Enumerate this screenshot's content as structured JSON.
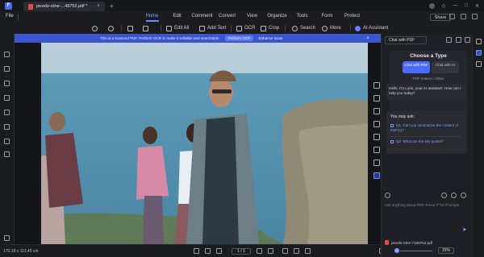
{
  "titlebar": {
    "tab_title": "pexels-rdne-...48752.pdf *",
    "tab_close": "×",
    "tab_add": "+"
  },
  "menubar": {
    "file": "File",
    "menus": [
      "Home",
      "Edit",
      "Comment",
      "Convert",
      "View",
      "Organize",
      "Tools",
      "Form",
      "Protect"
    ],
    "active": "Home",
    "share": "Share"
  },
  "toolbar": {
    "edit_all": "Edit All",
    "add_text": "Add Text",
    "ocr": "OCR",
    "crop": "Crop",
    "search": "Search",
    "more": "More",
    "ai_assistant": "AI Assistant"
  },
  "ocr_banner": {
    "message": "This is a scanned PDF. Perform OCR to make it editable and searchable.",
    "perform": "Perform OCR",
    "enhance": "Enhance Scan",
    "close": "×"
  },
  "statusbar": {
    "dimensions": "170.18 x 113.45 cm",
    "page": "1 / 1",
    "zoom": "15%"
  },
  "ai_panel": {
    "mode_select": "Chat with PDF",
    "choose_title": "Choose a Type",
    "option_pdf": "Chat with PDF",
    "option_ai": "Chat with AI",
    "option_sub": "PDF related / Other",
    "greeting": "Hello, I'm Lumi, your AI assistant. How can I help you today?",
    "you_may_ask": "You may ask:",
    "questions": [
      "Q1. Can you summarize the content of PDF(s)?",
      "Q2. What are the key points?"
    ],
    "input_placeholder": "Ask anything about PDF. Press '#' for Prompts",
    "file_ref": "pexels-rdne-7348752.pdf"
  },
  "colors": {
    "accent": "#4b6bff",
    "banner": "#3d55cc"
  }
}
